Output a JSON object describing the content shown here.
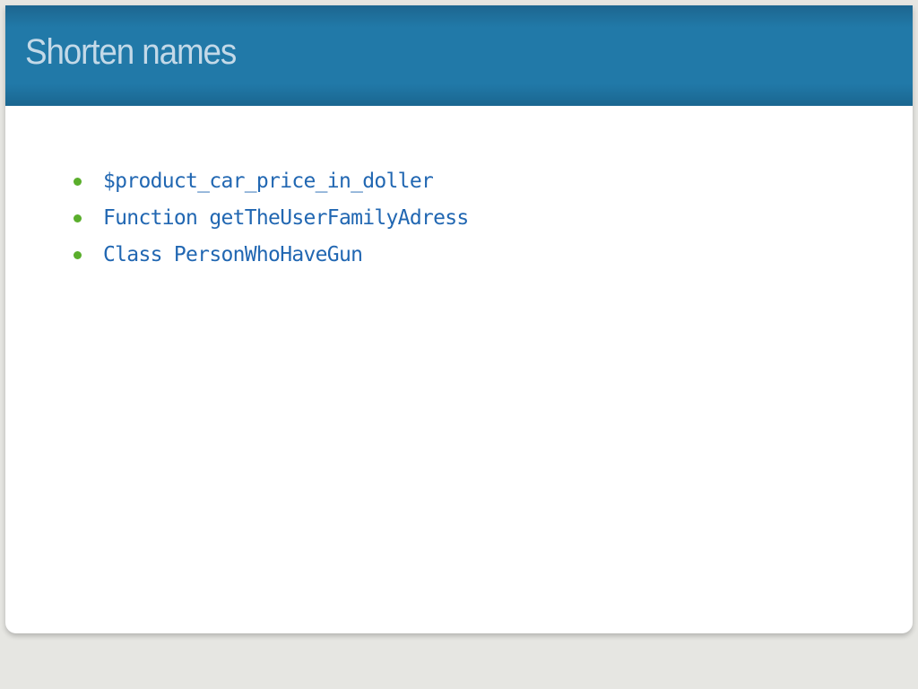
{
  "slide": {
    "title": "Shorten names",
    "bullets": [
      "$product_car_price_in_doller",
      "Function getTheUserFamilyAdress",
      "Class PersonWhoHaveGun"
    ]
  },
  "colors": {
    "header": "#2179a8",
    "title": "#c3d9e8",
    "bullet_dot": "#5aae2c",
    "code_text": "#2167b2",
    "background": "#e6e6e2"
  }
}
